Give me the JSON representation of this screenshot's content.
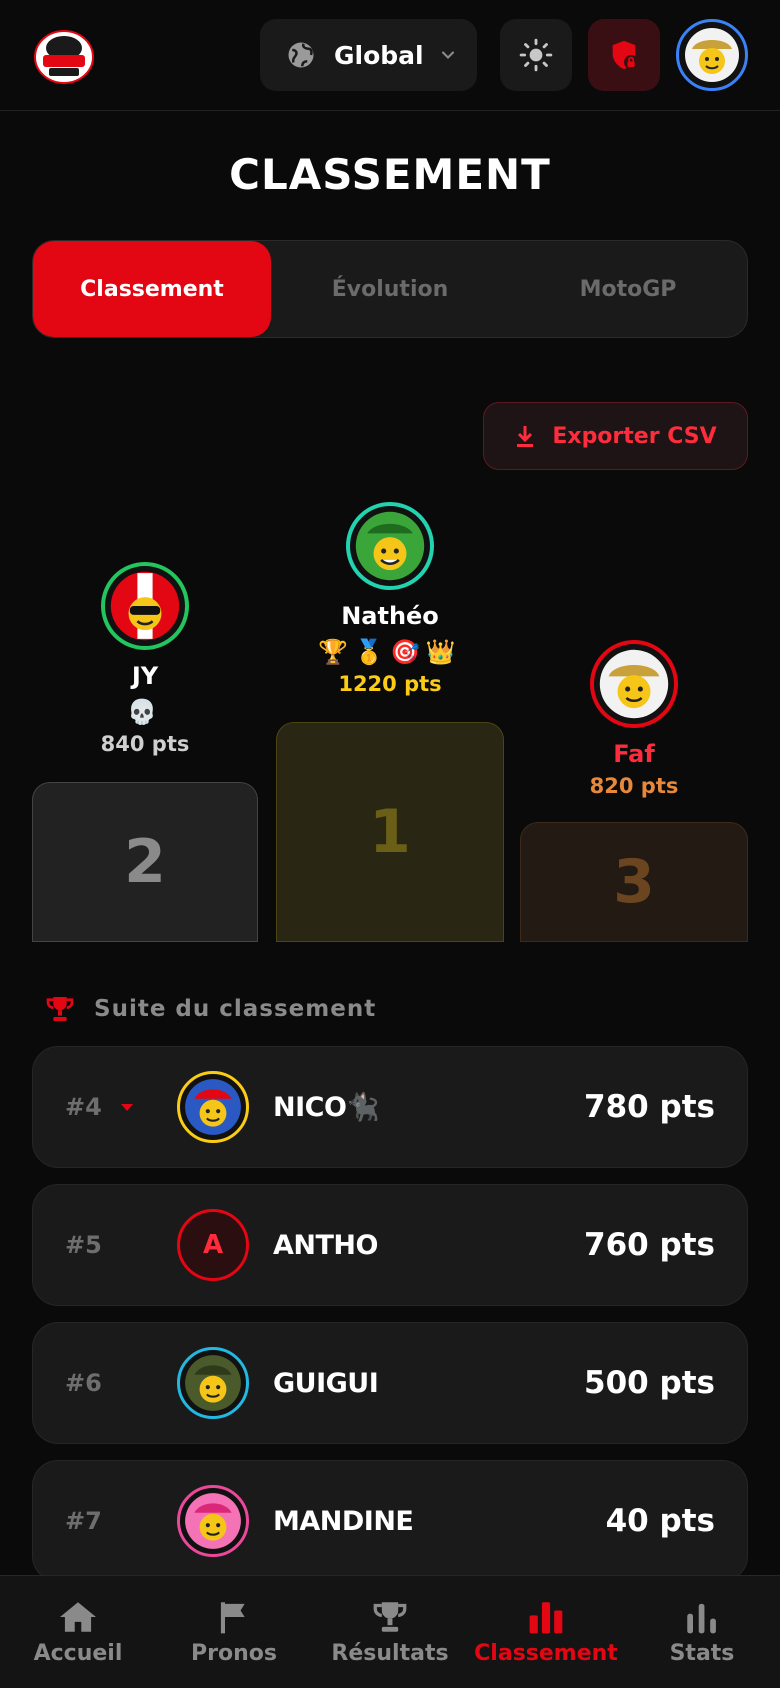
{
  "header": {
    "scope_label": "Global",
    "colors": {
      "accent": "#e30613",
      "avatar_ring": "#3b82f6"
    }
  },
  "page_title": "CLASSEMENT",
  "tabs": [
    {
      "label": "Classement",
      "active": true
    },
    {
      "label": "Évolution",
      "active": false
    },
    {
      "label": "MotoGP",
      "active": false
    }
  ],
  "export_label": "Exporter CSV",
  "podium": {
    "first": {
      "name": "Nathéo",
      "badges": "🏆🥇🎯👑",
      "points": "1220 pts",
      "place": "1",
      "ring": "#22d3b0"
    },
    "second": {
      "name": "JY",
      "badges": "💀",
      "points": "840 pts",
      "place": "2",
      "ring": "#22c55e"
    },
    "third": {
      "name": "Faf",
      "badges": "",
      "points": "820 pts",
      "place": "3",
      "ring": "#e30613"
    }
  },
  "section_title": "Suite du classement",
  "rows": [
    {
      "rank": "#4",
      "name": "NICO🐈‍⬛",
      "points": "780 pts",
      "ring": "#facc15",
      "trend": "down"
    },
    {
      "rank": "#5",
      "name": "ANTHO",
      "points": "760 pts",
      "ring": "#e30613",
      "initial": "A"
    },
    {
      "rank": "#6",
      "name": "GUIGUI",
      "points": "500 pts",
      "ring": "#22b8e0"
    },
    {
      "rank": "#7",
      "name": "MANDINE",
      "points": "40 pts",
      "ring": "#ec4899"
    }
  ],
  "nav": [
    {
      "label": "Accueil",
      "icon": "home-icon"
    },
    {
      "label": "Pronos",
      "icon": "flag-icon"
    },
    {
      "label": "Résultats",
      "icon": "trophy-icon"
    },
    {
      "label": "Classement",
      "icon": "bar-chart-icon",
      "active": true
    },
    {
      "label": "Stats",
      "icon": "stats-icon"
    }
  ]
}
